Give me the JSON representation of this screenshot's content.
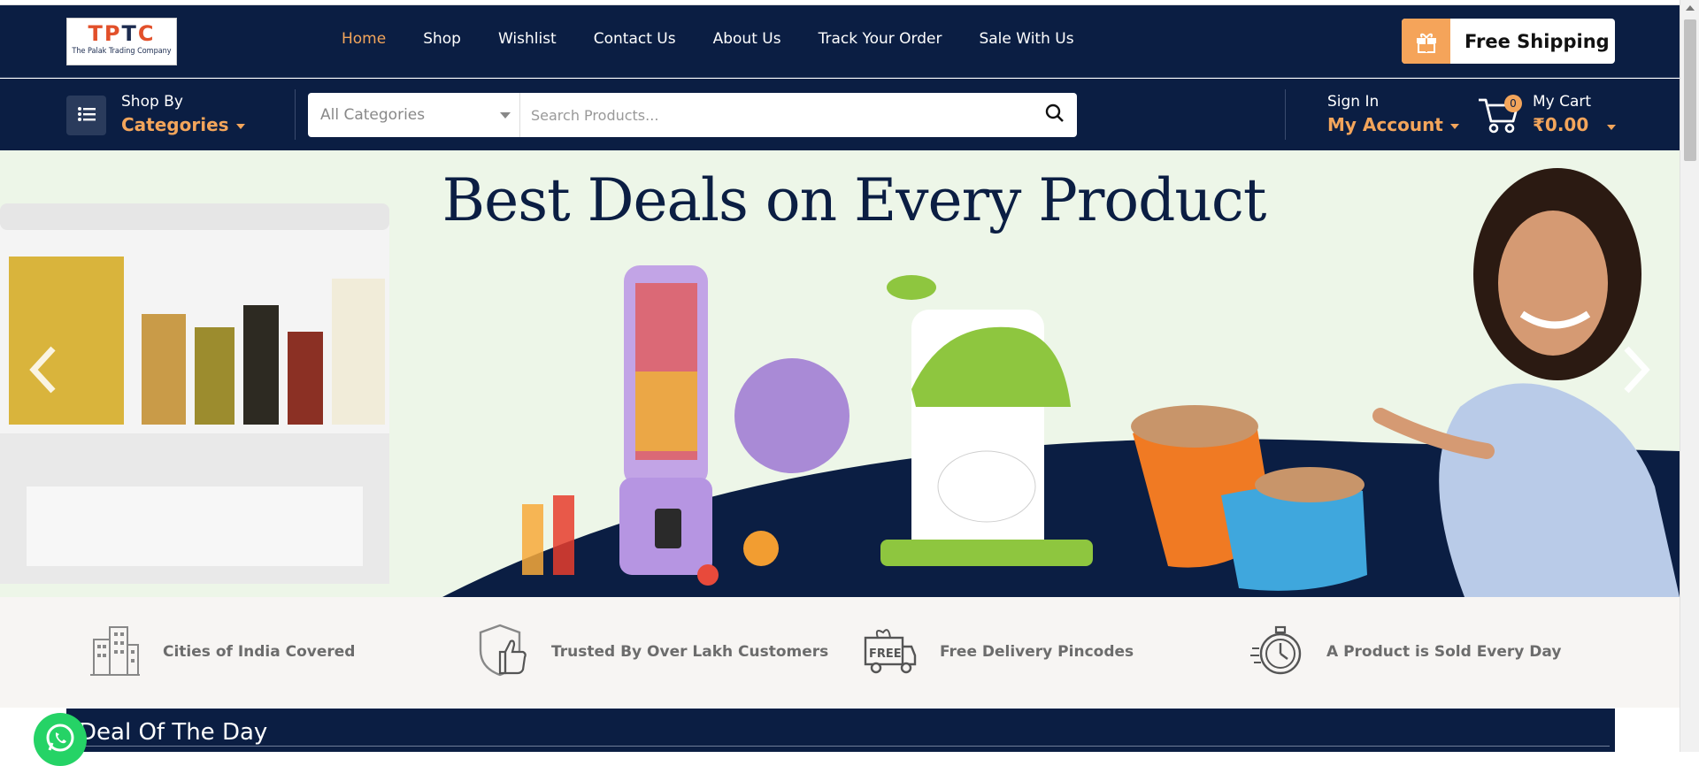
{
  "logo": {
    "mark": "TPTC",
    "subtitle": "The Palak Trading Company"
  },
  "nav": {
    "items": [
      {
        "label": "Home",
        "active": true
      },
      {
        "label": "Shop"
      },
      {
        "label": "Wishlist"
      },
      {
        "label": "Contact Us"
      },
      {
        "label": "About Us"
      },
      {
        "label": "Track Your Order"
      },
      {
        "label": "Sale With Us"
      }
    ]
  },
  "promo": {
    "free_shipping": "Free Shipping"
  },
  "categories": {
    "label_top": "Shop By",
    "label_main": "Categories"
  },
  "search": {
    "category_selected": "All Categories",
    "placeholder": "Search Products..."
  },
  "account": {
    "label_top": "Sign In",
    "label_main": "My Account"
  },
  "cart": {
    "label_top": "My Cart",
    "total": "₹0.00",
    "count": "0"
  },
  "hero": {
    "headline": "Best Deals on Every Product"
  },
  "stats": [
    {
      "label": "Cities of India Covered",
      "icon": "buildings-icon"
    },
    {
      "label": "Trusted By Over Lakh Customers",
      "icon": "shield-thumbs-up-icon"
    },
    {
      "label": "Free Delivery Pincodes",
      "icon": "free-delivery-truck-icon"
    },
    {
      "label": "A Product is Sold Every Day",
      "icon": "stopwatch-icon"
    }
  ],
  "deal": {
    "title": "Deal Of The Day"
  },
  "colors": {
    "navy": "#0b1e43",
    "accent": "#f3a55b",
    "whatsapp": "#25d366"
  }
}
